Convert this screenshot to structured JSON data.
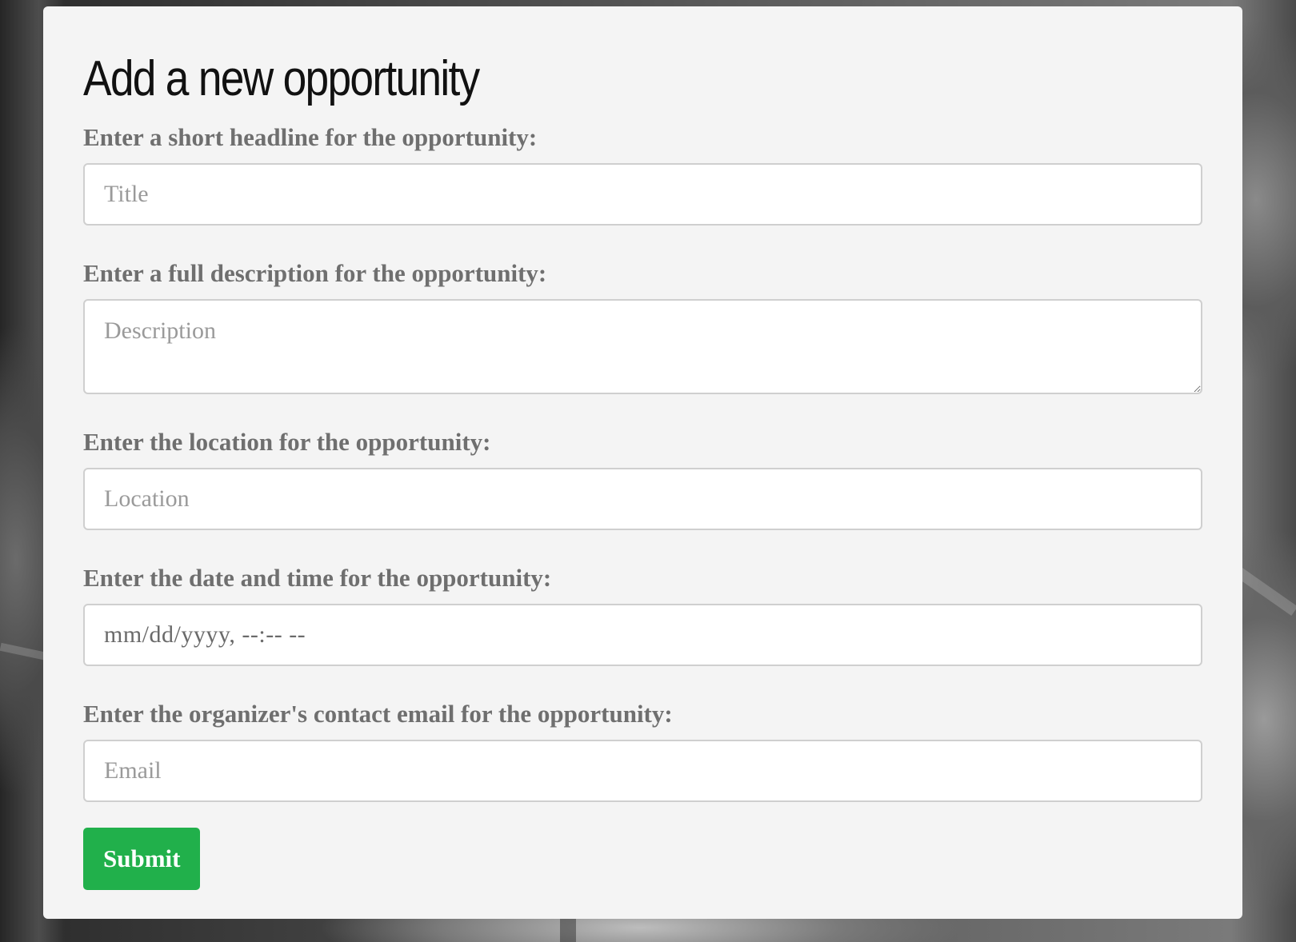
{
  "form": {
    "title": "Add a new opportunity",
    "fields": {
      "title": {
        "label": "Enter a short headline for the opportunity:",
        "placeholder": "Title",
        "value": ""
      },
      "description": {
        "label": "Enter a full description for the opportunity:",
        "placeholder": "Description",
        "value": ""
      },
      "location": {
        "label": "Enter the location for the opportunity:",
        "placeholder": "Location",
        "value": ""
      },
      "datetime": {
        "label": "Enter the date and time for the opportunity:",
        "display": "mm/dd/yyyy, --:-- --"
      },
      "email": {
        "label": "Enter the organizer's contact email for the opportunity:",
        "placeholder": "Email",
        "value": ""
      }
    },
    "submit_label": "Submit"
  },
  "colors": {
    "submit_bg": "#21b04b",
    "panel_bg": "#f4f4f4",
    "label_text": "#6f6f6f"
  }
}
